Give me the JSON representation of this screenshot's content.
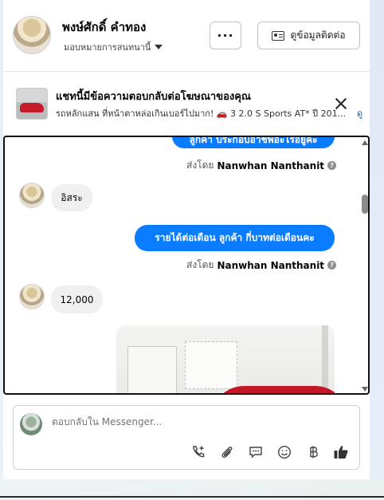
{
  "header": {
    "name": "พงษ์ศักดิ์ คำทอง",
    "assign_label": "มอบหมายการสนทนานี้",
    "more_label": "···",
    "contact_label": "ดูข้อมูลติดต่อ"
  },
  "ad": {
    "title": "แชทนี้มีข้อความตอบกลับต่อโฆษณาของคุณ",
    "subtitle": "รถหลักแสน ที่หน้าตาหล่อเกินเบอร์ไปมาก! 🚗 3 2.0 S Sports AT* ปี 201...",
    "link": "ดู"
  },
  "messages": {
    "out_1": "ลูกค้า ประกอบอาชีพอะไรอยู่คะ",
    "sent_by_prefix": "ส่งโดย",
    "sender": "Nanwhan Nanthanit",
    "in_1": "อิสระ",
    "out_2": "รายได้ต่อเดือน ลูกค้า   กี่บาทต่อเดือนคะ",
    "in_2": "12,000"
  },
  "composer": {
    "placeholder": "ตอบกลับใน Messenger..."
  },
  "colors": {
    "accent": "#0a7cff",
    "incoming_bubble": "#f0f0f0"
  },
  "icons": {
    "tools": [
      "phone-add-icon",
      "paperclip-icon",
      "chat-icon",
      "emoji-icon",
      "baht-icon",
      "thumbs-up-icon"
    ]
  }
}
